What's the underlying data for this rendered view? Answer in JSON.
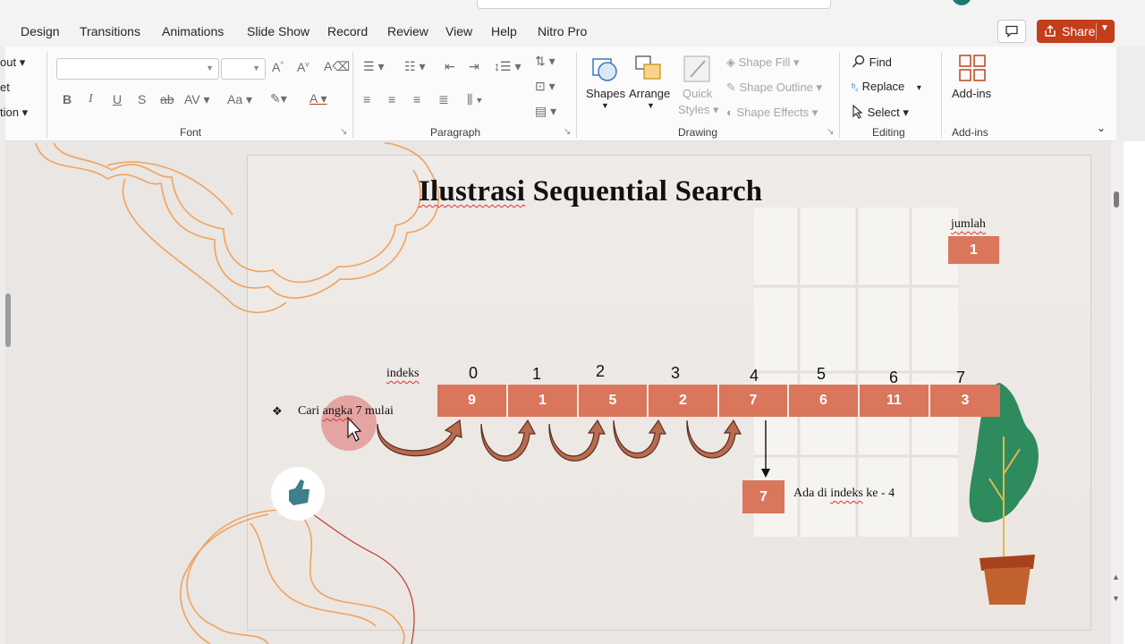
{
  "menu_tabs": [
    "Design",
    "Transitions",
    "Animations",
    "Slide Show",
    "Record",
    "Review",
    "View",
    "Help",
    "Nitro Pro"
  ],
  "share_label": "Share",
  "ribbon": {
    "left_cut": [
      "out",
      "et",
      "tion"
    ],
    "groups": {
      "font": "Font",
      "paragraph": "Paragraph",
      "drawing": "Drawing",
      "editing": "Editing",
      "addins": "Add-ins"
    },
    "font_buttons": [
      "B",
      "I",
      "U",
      "S",
      "ab",
      "AV",
      "Aa"
    ],
    "drawing": {
      "shapes": "Shapes",
      "arrange": "Arrange",
      "quick_styles_1": "Quick",
      "quick_styles_2": "Styles",
      "shape_fill": "Shape Fill",
      "shape_outline": "Shape Outline",
      "shape_effects": "Shape Effects"
    },
    "editing": {
      "find": "Find",
      "replace": "Replace",
      "select": "Select"
    },
    "addins_button": "Add-ins"
  },
  "slide": {
    "title_part1": "Ilustrasi",
    "title_part2": "Sequential Search",
    "jumlah_label": "jumlah",
    "jumlah_value": "1",
    "indeks_label": "indeks",
    "indices": [
      "0",
      "1",
      "2",
      "3",
      "4",
      "5",
      "6",
      "7"
    ],
    "values": [
      "9",
      "1",
      "5",
      "2",
      "7",
      "6",
      "11",
      "3"
    ],
    "bullet_text_1": "Cari",
    "bullet_text_2": "angka",
    "bullet_text_3": "7 mulai",
    "bullet_glyph": "❖",
    "result_value": "7",
    "result_text_1": "Ada di",
    "result_text_2": "indeks",
    "result_text_3": "ke - 4"
  },
  "colors": {
    "cell_fill": "#d9765c",
    "share_bg": "#c43e1c",
    "arrow_fill": "#b96a4f",
    "doodle": "#f0a35e",
    "plant": "#2e8b5e",
    "pot": "#c2622f"
  }
}
